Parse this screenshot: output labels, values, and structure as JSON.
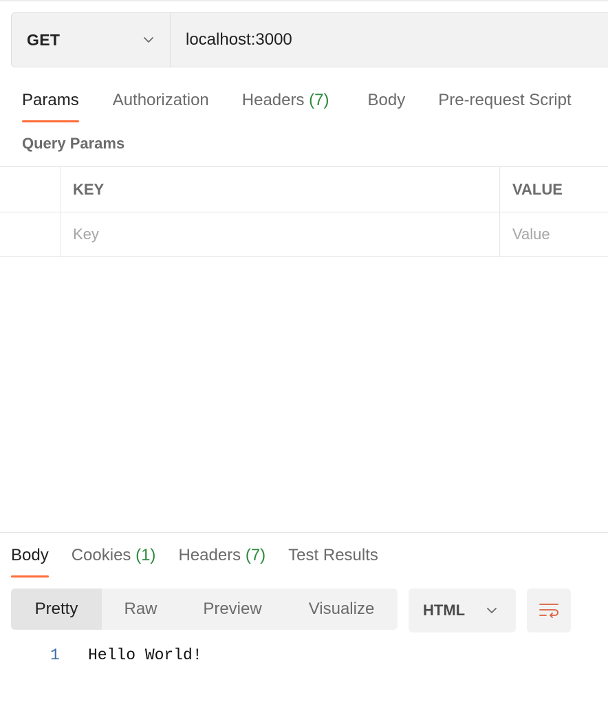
{
  "request": {
    "method": "GET",
    "url": "localhost:3000"
  },
  "request_tabs": [
    {
      "label": "Params",
      "count": "",
      "active": true
    },
    {
      "label": "Authorization",
      "count": "",
      "active": false
    },
    {
      "label": "Headers",
      "count": "(7)",
      "active": false
    },
    {
      "label": "Body",
      "count": "",
      "active": false
    },
    {
      "label": "Pre-request Script",
      "count": "",
      "active": false
    }
  ],
  "query_params": {
    "title": "Query Params",
    "columns": [
      "KEY",
      "VALUE"
    ],
    "placeholders": {
      "key": "Key",
      "value": "Value"
    }
  },
  "response_tabs": [
    {
      "label": "Body",
      "count": "",
      "active": true
    },
    {
      "label": "Cookies",
      "count": "(1)",
      "active": false
    },
    {
      "label": "Headers",
      "count": "(7)",
      "active": false
    },
    {
      "label": "Test Results",
      "count": "",
      "active": false
    }
  ],
  "view_modes": [
    "Pretty",
    "Raw",
    "Preview",
    "Visualize"
  ],
  "active_view": "Pretty",
  "format": "HTML",
  "wrap_icon": "wrap-lines-icon",
  "body_lines": [
    {
      "no": "1",
      "text": "Hello World!"
    }
  ],
  "colors": {
    "accent": "#ff6c37",
    "count_green": "#2b8a3e",
    "line_number_blue": "#3a6ea5"
  }
}
